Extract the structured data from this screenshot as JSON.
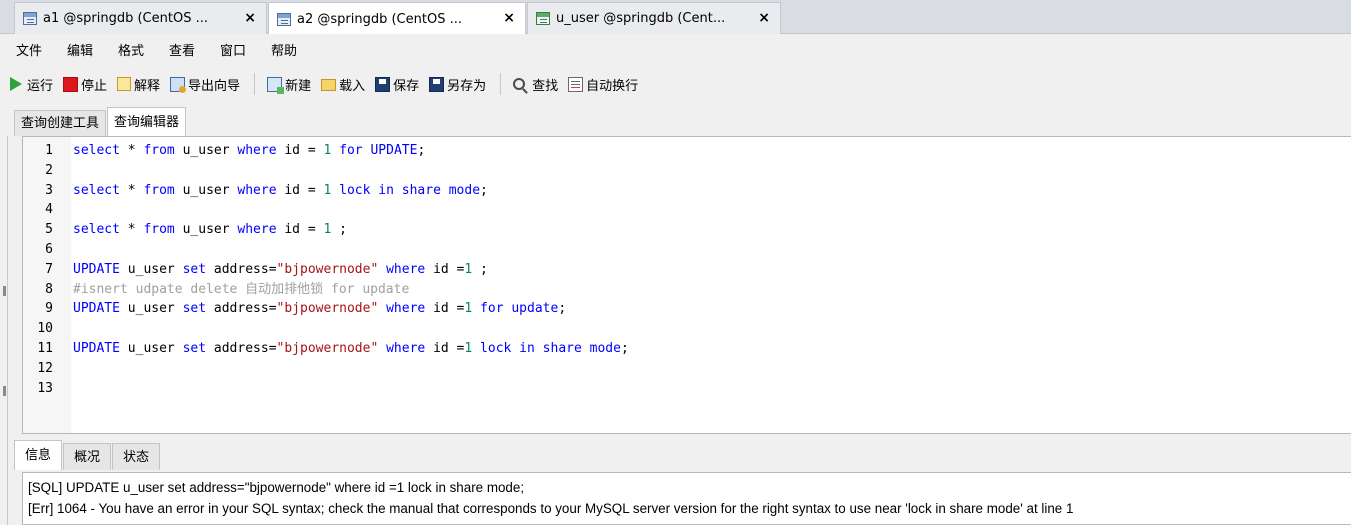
{
  "window_tabs": [
    {
      "label": "a1 @springdb (CentOS ...",
      "icon": "query-icon",
      "active": false,
      "close": "×"
    },
    {
      "label": "a2 @springdb (CentOS ...",
      "icon": "query-icon",
      "active": true,
      "close": "×"
    },
    {
      "label": "u_user @springdb (Cent...",
      "icon": "table-icon",
      "active": false,
      "close": "×"
    }
  ],
  "menu": [
    "文件",
    "编辑",
    "格式",
    "查看",
    "窗口",
    "帮助"
  ],
  "toolbar": {
    "run": "运行",
    "stop": "停止",
    "explain": "解释",
    "export_wizard": "导出向导",
    "new": "新建",
    "load": "载入",
    "save": "保存",
    "save_as": "另存为",
    "find": "查找",
    "word_wrap": "自动换行"
  },
  "editor_tabs": {
    "query_builder": "查询创建工具",
    "query_editor": "查询编辑器"
  },
  "code_lines": [
    {
      "n": "1",
      "tokens": [
        [
          "kw",
          "select"
        ],
        [
          "id",
          " * "
        ],
        [
          "kw",
          "from"
        ],
        [
          "id",
          " u_user "
        ],
        [
          "kw",
          "where"
        ],
        [
          "id",
          " id = "
        ],
        [
          "num",
          "1"
        ],
        [
          "id",
          " "
        ],
        [
          "kw",
          "for UPDATE"
        ],
        [
          "id",
          ";"
        ]
      ]
    },
    {
      "n": "2",
      "tokens": []
    },
    {
      "n": "3",
      "tokens": [
        [
          "kw",
          "select"
        ],
        [
          "id",
          " * "
        ],
        [
          "kw",
          "from"
        ],
        [
          "id",
          " u_user "
        ],
        [
          "kw",
          "where"
        ],
        [
          "id",
          " id = "
        ],
        [
          "num",
          "1"
        ],
        [
          "id",
          " "
        ],
        [
          "kw",
          "lock in share mode"
        ],
        [
          "id",
          ";"
        ]
      ]
    },
    {
      "n": "4",
      "tokens": []
    },
    {
      "n": "5",
      "tokens": [
        [
          "kw",
          "select"
        ],
        [
          "id",
          " * "
        ],
        [
          "kw",
          "from"
        ],
        [
          "id",
          " u_user "
        ],
        [
          "kw",
          "where"
        ],
        [
          "id",
          " id = "
        ],
        [
          "num",
          "1"
        ],
        [
          "id",
          " ;"
        ]
      ]
    },
    {
      "n": "6",
      "tokens": []
    },
    {
      "n": "7",
      "tokens": [
        [
          "kw",
          "UPDATE"
        ],
        [
          "id",
          " u_user "
        ],
        [
          "kw",
          "set"
        ],
        [
          "id",
          " address="
        ],
        [
          "str",
          "\"bjpowernode\""
        ],
        [
          "id",
          " "
        ],
        [
          "kw",
          "where"
        ],
        [
          "id",
          " id ="
        ],
        [
          "num",
          "1"
        ],
        [
          "id",
          " ;"
        ]
      ]
    },
    {
      "n": "8",
      "tokens": [
        [
          "cmt",
          "#isnert udpate delete 自动加排他锁 for update"
        ]
      ]
    },
    {
      "n": "9",
      "tokens": [
        [
          "kw",
          "UPDATE"
        ],
        [
          "id",
          " u_user "
        ],
        [
          "kw",
          "set"
        ],
        [
          "id",
          " address="
        ],
        [
          "str",
          "\"bjpowernode\""
        ],
        [
          "id",
          " "
        ],
        [
          "kw",
          "where"
        ],
        [
          "id",
          " id ="
        ],
        [
          "num",
          "1"
        ],
        [
          "id",
          " "
        ],
        [
          "kw",
          "for update"
        ],
        [
          "id",
          ";"
        ]
      ]
    },
    {
      "n": "10",
      "tokens": []
    },
    {
      "n": "11",
      "tokens": [
        [
          "kw",
          "UPDATE"
        ],
        [
          "id",
          " u_user "
        ],
        [
          "kw",
          "set"
        ],
        [
          "id",
          " address="
        ],
        [
          "str",
          "\"bjpowernode\""
        ],
        [
          "id",
          " "
        ],
        [
          "kw",
          "where"
        ],
        [
          "id",
          " id ="
        ],
        [
          "num",
          "1"
        ],
        [
          "id",
          " "
        ],
        [
          "kw",
          "lock in share mode"
        ],
        [
          "id",
          ";"
        ]
      ]
    },
    {
      "n": "12",
      "tokens": []
    },
    {
      "n": "13",
      "tokens": []
    }
  ],
  "result_tabs": {
    "info": "信息",
    "profile": "概况",
    "status": "状态"
  },
  "messages": {
    "sql": "[SQL] UPDATE u_user set address=\"bjpowernode\" where id =1 lock in share mode;",
    "err": "[Err] 1064 - You have an error in your SQL syntax; check the manual that corresponds to your MySQL server version for the right syntax to use near 'lock in share mode' at line 1"
  },
  "colors": {
    "keyword": "#0000ff",
    "string": "#a31515",
    "number": "#098658",
    "comment": "#a0a0a0"
  }
}
